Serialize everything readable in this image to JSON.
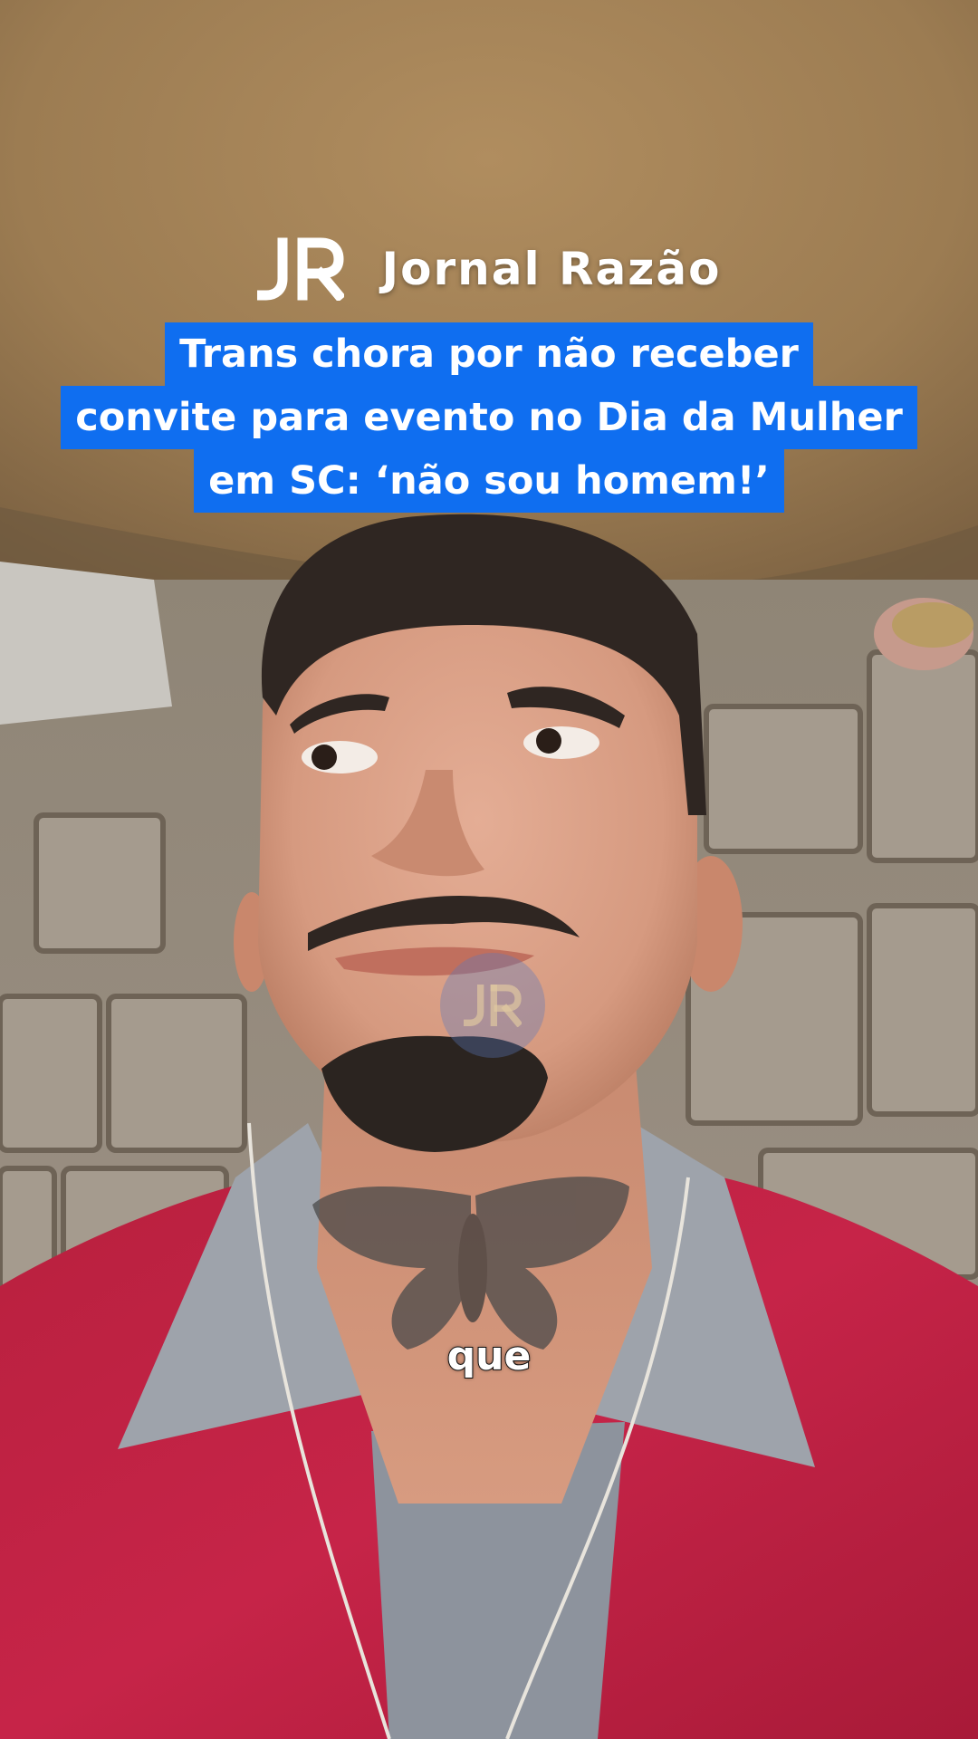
{
  "brand": {
    "logo_letters": "JR",
    "name": "Jornal Razão",
    "logo_color": "#ffffff"
  },
  "headline": {
    "lines": [
      "Trans chora por não receber",
      "convite para evento no Dia da Mulher",
      "em SC: ‘não sou homem!’"
    ],
    "band_color": "#0f6ef0",
    "text_color": "#ffffff"
  },
  "caption": {
    "text": "que"
  },
  "watermark": {
    "logo_letters": "JR"
  }
}
